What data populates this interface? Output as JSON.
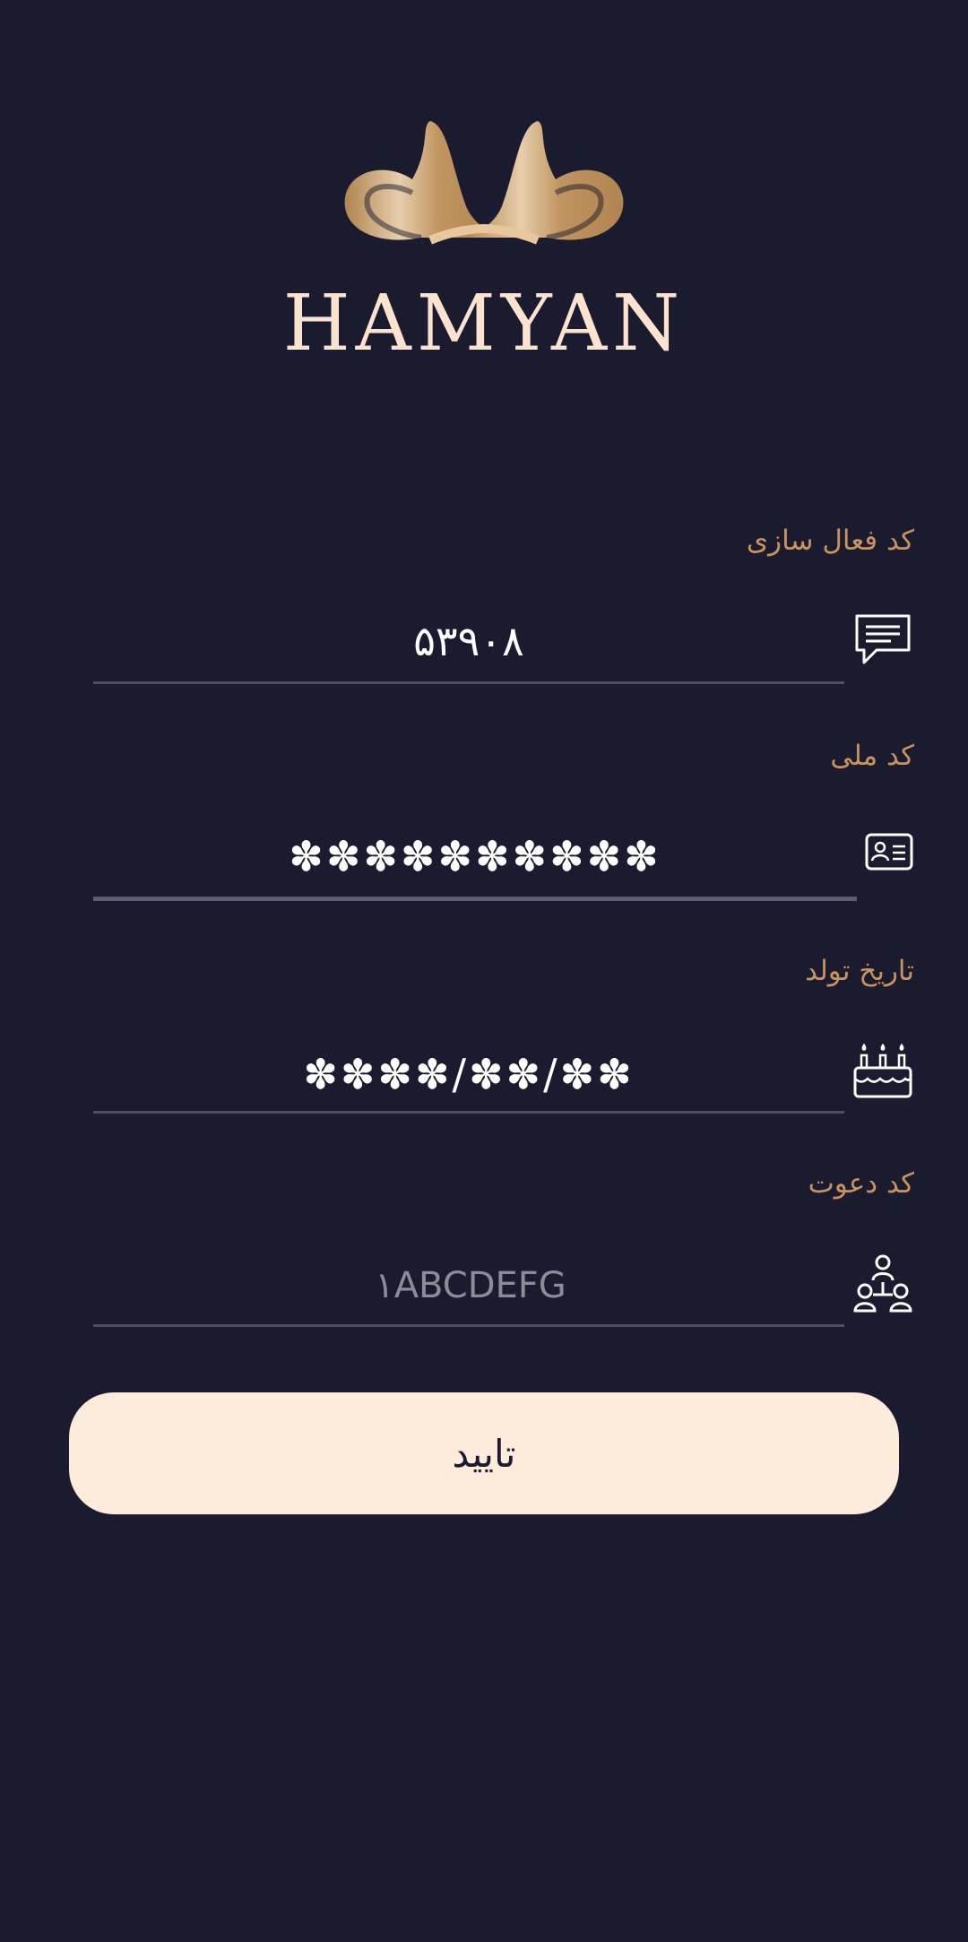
{
  "brand": {
    "name": "HAMYAN"
  },
  "colors": {
    "background": "#1a1b2e",
    "label": "#c9935e",
    "button_bg": "#fdebdb",
    "logo_gold": "#d7ad7a"
  },
  "fields": {
    "activation_code": {
      "label": "کد فعال سازی",
      "value": "۵۳۹۰۸",
      "icon": "message-icon"
    },
    "national_id": {
      "label": "کد ملی",
      "value": "✽✽✽✽✽✽✽✽✽✽",
      "icon": "id-card-icon"
    },
    "birth_date": {
      "label": "تاریخ تولد",
      "value": "✽✽✽✽/✽✽/✽✽",
      "icon": "birthday-cake-icon"
    },
    "invite_code": {
      "label": "کد دعوت",
      "value": "",
      "placeholder": "۱ABCDEFG",
      "icon": "people-network-icon"
    }
  },
  "confirm_button": {
    "label": "تایید"
  }
}
